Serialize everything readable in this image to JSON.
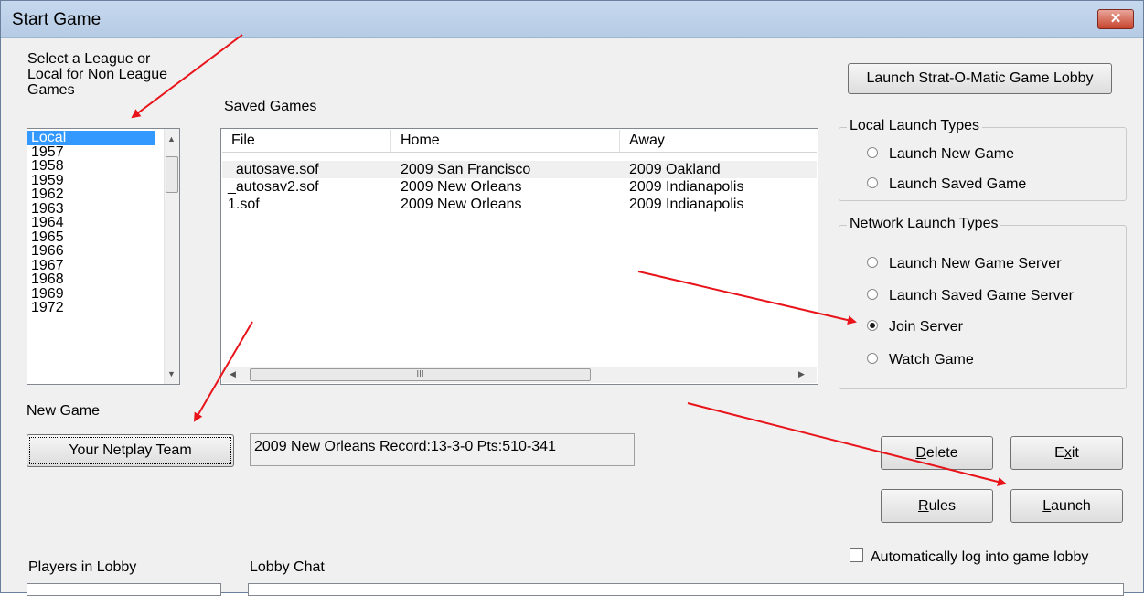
{
  "window": {
    "title": "Start Game"
  },
  "league": {
    "label_lines": [
      "Select a League or",
      "Local for Non League",
      "Games"
    ],
    "items": [
      "Local",
      "1957",
      "1958",
      "1959",
      "1962",
      "1963",
      "1964",
      "1965",
      "1966",
      "1967",
      "1968",
      "1969",
      "1972"
    ],
    "selected": "Local"
  },
  "saved_games": {
    "label": "Saved Games",
    "columns": [
      "File",
      "Home",
      "Away"
    ],
    "rows": [
      {
        "file": "_autosave.sof",
        "home": "2009 San Francisco",
        "away": "2009 Oakland"
      },
      {
        "file": "_autosav2.sof",
        "home": "2009 New Orleans",
        "away": "2009 Indianapolis"
      },
      {
        "file": "1.sof",
        "home": "2009 New Orleans",
        "away": "2009 Indianapolis"
      }
    ],
    "scroll_thumb": "III"
  },
  "lobby_button": "Launch Strat-O-Matic Game Lobby",
  "local_launch": {
    "title": "Local Launch Types",
    "options": [
      "Launch New Game",
      "Launch Saved Game"
    ]
  },
  "network_launch": {
    "title": "Network Launch Types",
    "options": [
      "Launch New Game Server",
      "Launch Saved Game Server",
      "Join Server",
      "Watch Game"
    ],
    "selected": "Join Server"
  },
  "new_game": {
    "label": "New Game",
    "button": "Your Netplay Team",
    "team_info": "2009 New Orleans  Record:13-3-0 Pts:510-341"
  },
  "buttons": {
    "delete": {
      "ul": "D",
      "rest": "elete"
    },
    "exit": {
      "pre": "E",
      "ul": "x",
      "rest": "it"
    },
    "rules": {
      "ul": "R",
      "rest": "ules"
    },
    "launch": {
      "ul": "L",
      "rest": "aunch"
    }
  },
  "auto_login": {
    "label": "Automatically log into game lobby",
    "checked": false
  },
  "players_label": "Players in Lobby",
  "chat_label": "Lobby Chat",
  "annotation_color": "#e8141a"
}
